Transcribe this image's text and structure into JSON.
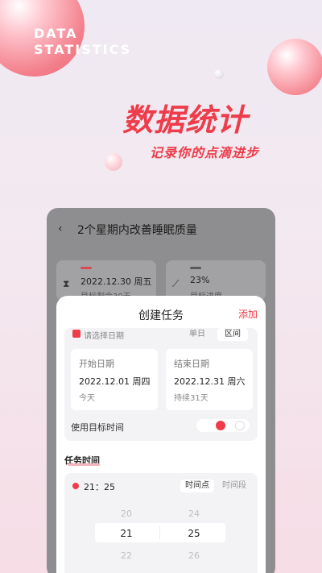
{
  "header": {
    "en_line1": "DATA",
    "en_line2": "STATISTICS",
    "title": "数据统计",
    "subtitle": "记录你的点滴进步"
  },
  "colors": {
    "accent": "#ee3c4a",
    "phone_bg": "#8e8e90",
    "sheet_bg": "#ffffff"
  },
  "phone": {
    "back_icon": "chevron-left-icon",
    "title": "2个星期内改善睡眠质量",
    "stats": [
      {
        "icon": "hourglass-icon",
        "main": "2022.12.30 周五",
        "sub": "目标剩余30天"
      },
      {
        "icon": "trend-chart-icon",
        "main": "23%",
        "sub": "目标进度"
      }
    ]
  },
  "sheet": {
    "title": "创建任务",
    "add_label": "添加",
    "date": {
      "hint": "请选择日期",
      "seg_single": "单日",
      "seg_range": "区间",
      "start": {
        "label": "开始日期",
        "date": "2022.12.01 周四",
        "note": "今天"
      },
      "end": {
        "label": "结束日期",
        "date": "2022.12.31 周六",
        "note": "持续31天"
      },
      "use_target_time": "使用目标时间"
    },
    "task_time": {
      "label": "任务时间",
      "value": "21：25",
      "seg_point": "时间点",
      "seg_period": "时间段",
      "hours": [
        "20",
        "21",
        "22"
      ],
      "minutes": [
        "24",
        "25",
        "26"
      ]
    }
  }
}
